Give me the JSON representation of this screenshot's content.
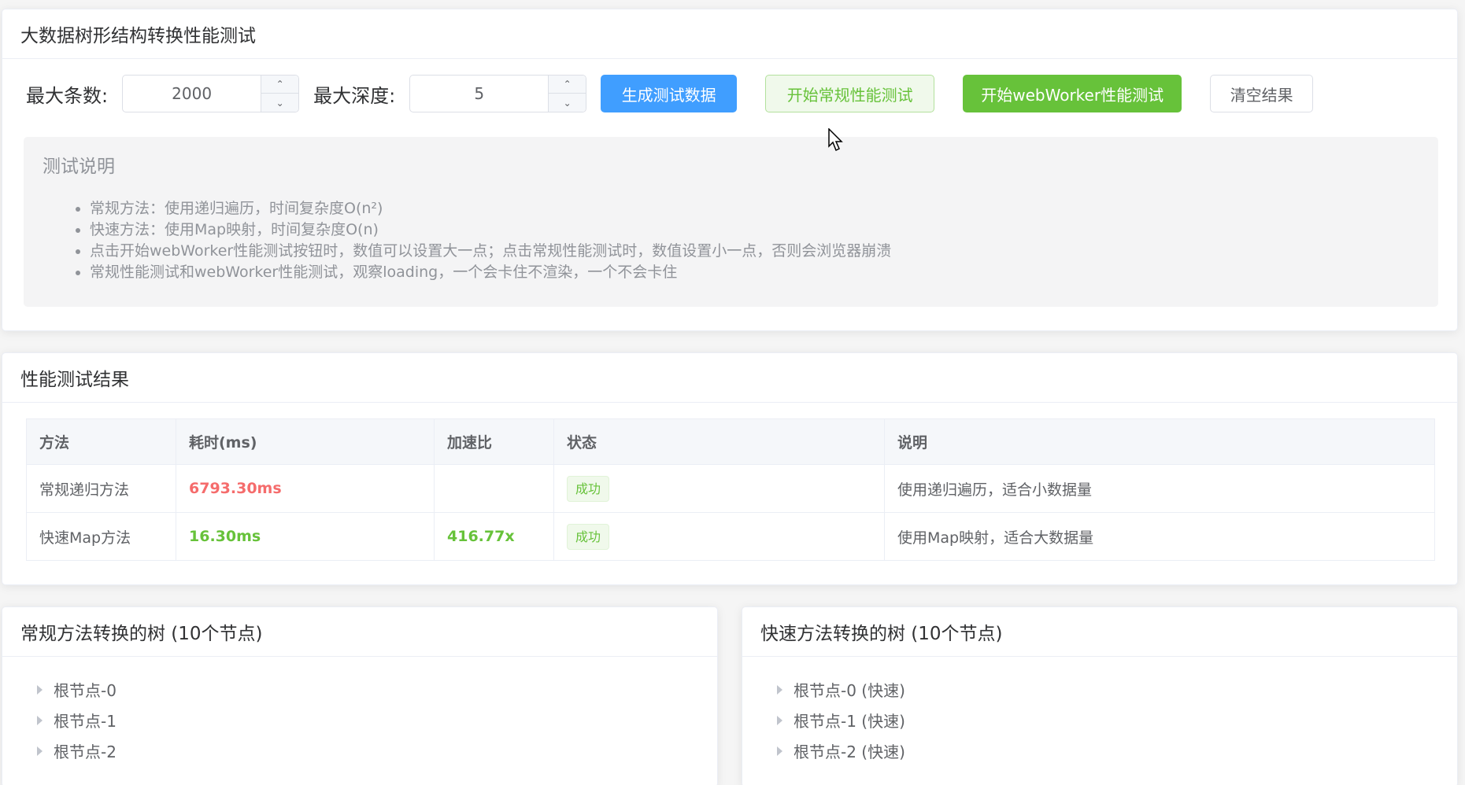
{
  "config_card": {
    "title": "大数据树形结构转换性能测试",
    "max_count_label": "最大条数:",
    "max_count_value": "2000",
    "max_depth_label": "最大深度:",
    "max_depth_value": "5",
    "btn_generate": "生成测试数据",
    "btn_normal_test": "开始常规性能测试",
    "btn_worker_test": "开始webWorker性能测试",
    "btn_clear": "清空结果",
    "desc_title": "测试说明",
    "desc_items": [
      "常规方法：使用递归遍历，时间复杂度O(n²)",
      "快速方法：使用Map映射，时间复杂度O(n)",
      "点击开始webWorker性能测试按钮时，数值可以设置大一点；点击常规性能测试时，数值设置小一点，否则会浏览器崩溃",
      "常规性能测试和webWorker性能测试，观察loading，一个会卡住不渲染，一个不会卡住"
    ]
  },
  "results_card": {
    "title": "性能测试结果",
    "columns": [
      "方法",
      "耗时(ms)",
      "加速比",
      "状态",
      "说明"
    ],
    "rows": [
      {
        "method": "常规递归方法",
        "time": "6793.30ms",
        "speedup": "",
        "status": "成功",
        "note": "使用递归遍历，适合小数据量"
      },
      {
        "method": "快速Map方法",
        "time": "16.30ms",
        "speedup": "416.77x",
        "status": "成功",
        "note": "使用Map映射，适合大数据量"
      }
    ]
  },
  "tree_normal": {
    "title": "常规方法转换的树 (10个节点)",
    "nodes": [
      "根节点-0",
      "根节点-1",
      "根节点-2"
    ]
  },
  "tree_fast": {
    "title": "快速方法转换的树 (10个节点)",
    "nodes": [
      "根节点-0 (快速)",
      "根节点-1 (快速)",
      "根节点-2 (快速)"
    ]
  },
  "colors": {
    "primary": "#409eff",
    "success": "#67c23a",
    "danger": "#f56c6c"
  }
}
